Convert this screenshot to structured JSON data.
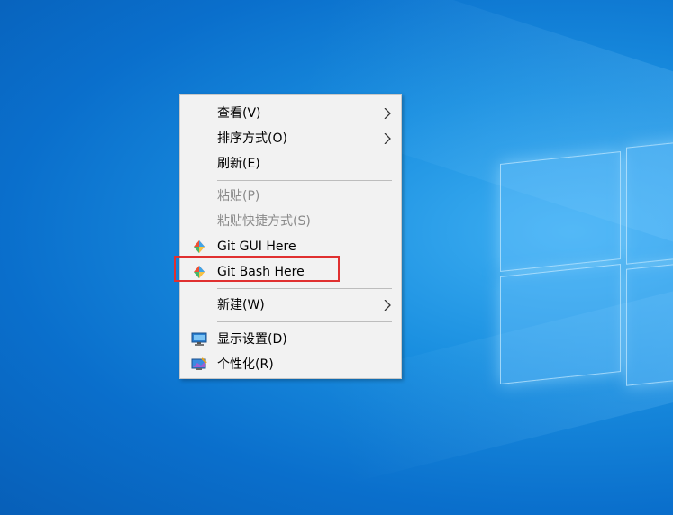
{
  "context_menu": {
    "items": [
      {
        "label": "查看(V)",
        "has_submenu": true,
        "enabled": true
      },
      {
        "label": "排序方式(O)",
        "has_submenu": true,
        "enabled": true
      },
      {
        "label": "刷新(E)",
        "has_submenu": false,
        "enabled": true
      },
      {
        "label": "粘贴(P)",
        "has_submenu": false,
        "enabled": false
      },
      {
        "label": "粘贴快捷方式(S)",
        "has_submenu": false,
        "enabled": false
      },
      {
        "label": "Git GUI Here",
        "icon": "git-icon",
        "enabled": true
      },
      {
        "label": "Git Bash Here",
        "icon": "git-icon",
        "enabled": true,
        "highlighted": true
      },
      {
        "label": "新建(W)",
        "has_submenu": true,
        "enabled": true
      },
      {
        "label": "显示设置(D)",
        "icon": "display-settings-icon",
        "enabled": true
      },
      {
        "label": "个性化(R)",
        "icon": "personalize-icon",
        "enabled": true
      }
    ]
  },
  "colors": {
    "desktop_blue": "#0a6fcc",
    "menu_bg": "#f2f2f2",
    "highlight_outline": "#e03030"
  }
}
